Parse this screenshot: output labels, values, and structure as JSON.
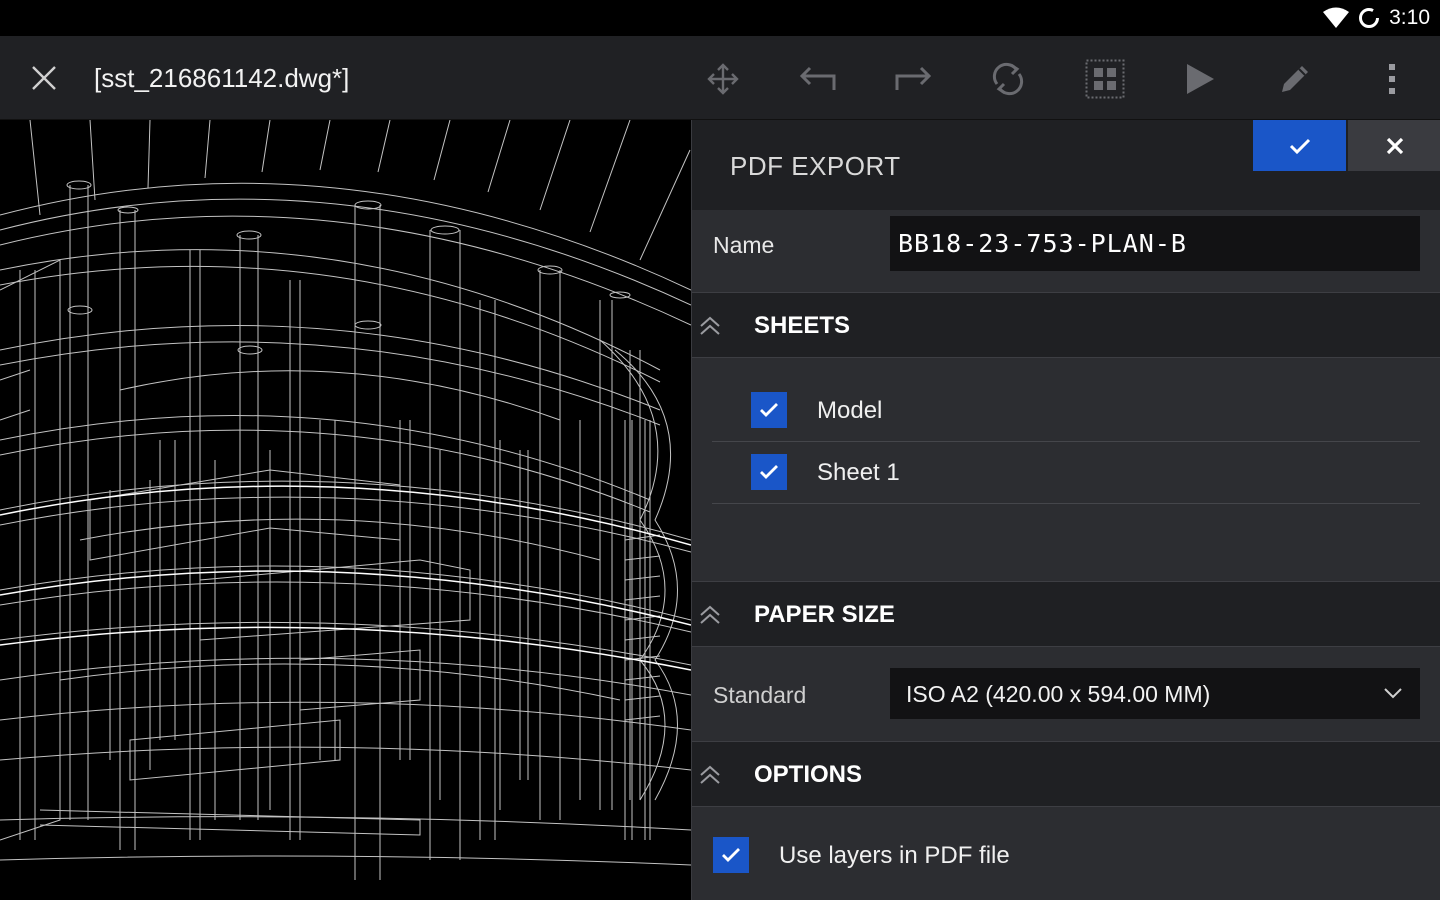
{
  "status_bar": {
    "time": "3:10"
  },
  "toolbar": {
    "title": "[sst_216861142.dwg*]"
  },
  "panel": {
    "title": "PDF EXPORT",
    "name_label": "Name",
    "name_value": "BB18-23-753-PLAN-B",
    "sheets": {
      "title": "SHEETS",
      "items": [
        {
          "label": "Model",
          "checked": true
        },
        {
          "label": "Sheet 1",
          "checked": true
        }
      ]
    },
    "paper_size": {
      "title": "PAPER SIZE",
      "standard_label": "Standard",
      "standard_value": "ISO A2 (420.00 x 594.00 MM)"
    },
    "options": {
      "title": "OPTIONS",
      "use_layers_label": "Use layers in PDF file",
      "use_layers_checked": true
    }
  },
  "colors": {
    "accent": "#1a56c8",
    "panel_bg": "#2c2d31",
    "header_bg": "#1f2023",
    "toolbar_bg": "#202124"
  }
}
